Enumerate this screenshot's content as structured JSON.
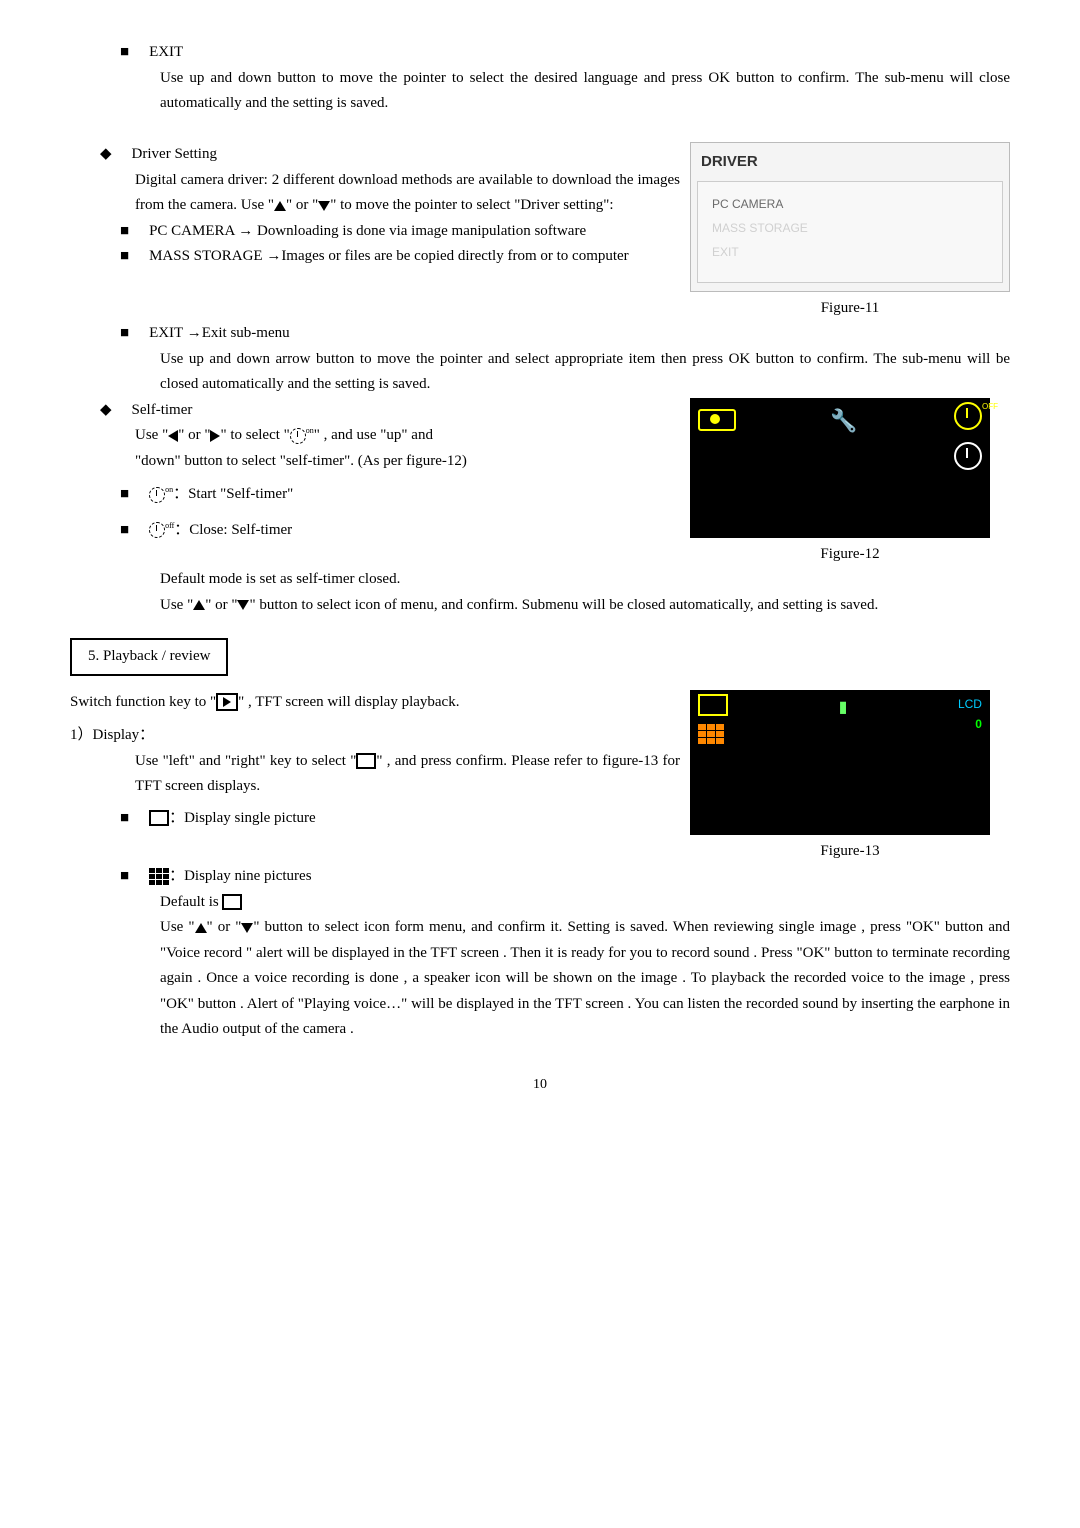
{
  "section_exit": {
    "title": "EXIT",
    "body": "Use up and down button to move the pointer to select the desired language and press OK button to confirm. The sub-menu will close automatically and the setting is saved."
  },
  "driver": {
    "heading": "Driver Setting",
    "intro1": "Digital camera driver: 2 different download methods are available to download the images from the camera. Use",
    "intro2_prefix": "\"",
    "intro2_mid": "\" or \"",
    "intro2_suffix": "\" to move the pointer to select \"Driver setting\":",
    "pc_camera": "PC CAMERA → Downloading is done via image manipulation software",
    "mass_storage": "MASS STORAGE →Images or files are be copied directly from or to computer",
    "exit_sub": "EXIT →Exit sub-menu",
    "finish": "Use up and down arrow button to move the pointer and select appropriate item then press OK button to confirm. The sub-menu will be closed automatically and the setting is saved.",
    "fig_caption": "Figure-11",
    "box_header": "DRIVER",
    "box_items": [
      "PC CAMERA",
      "MASS STORAGE",
      "EXIT"
    ]
  },
  "selftimer": {
    "heading": "Self-timer",
    "use_line_pre": "Use \"",
    "use_line_mid": "\" or \"",
    "use_line_post": "\"  to select \"",
    "use_line_end": "\" ,  and use \"up\" and",
    "second_line": "\"down\" button to select \"self-timer\". (As per figure-12)",
    "start": "：Start \"Self-timer\"",
    "close": "：Close: Self-timer",
    "default": "Default mode is set as self-timer closed.",
    "use2_pre": "Use  \"",
    "use2_mid": "\"  or  \"",
    "use2_post": "\"  button to select icon of menu, and confirm. Submenu will be closed automatically, and setting is saved.",
    "fig_caption": "Figure-12"
  },
  "playback": {
    "section_title": "5. Playback / review",
    "switch_pre": "Switch function key to \"",
    "switch_post": "\" ,  TFT screen will display playback.",
    "display_head": "1）Display：",
    "display_body_pre": "Use \"left\" and \"right\" key to select \"",
    "display_body_post": "\" , and press confirm. Please refer to figure-13 for TFT screen displays.",
    "single": "：Display single picture",
    "nine": "：Display nine pictures",
    "default_pre": "Default is ",
    "use_pre": "Use  \"",
    "use_mid": "\"  or  \"",
    "use_post": "\"  button to select icon form menu, and confirm it. Setting is saved. When reviewing single image , press \"OK\" button and \"Voice record \" alert will be displayed in the TFT screen . Then it is ready for you to record sound . Press \"OK\" button to terminate recording again . Once a voice recording is done , a speaker icon will be shown on the image . To playback the recorded voice to the image , press \"OK\" button . Alert of \"Playing voice…\" will be displayed in the TFT screen . You can listen the recorded sound by inserting the earphone in the Audio output of the camera .",
    "fig_caption": "Figure-13",
    "lcd_label": "LCD",
    "lcd_zero": "0"
  },
  "page_number": "10"
}
